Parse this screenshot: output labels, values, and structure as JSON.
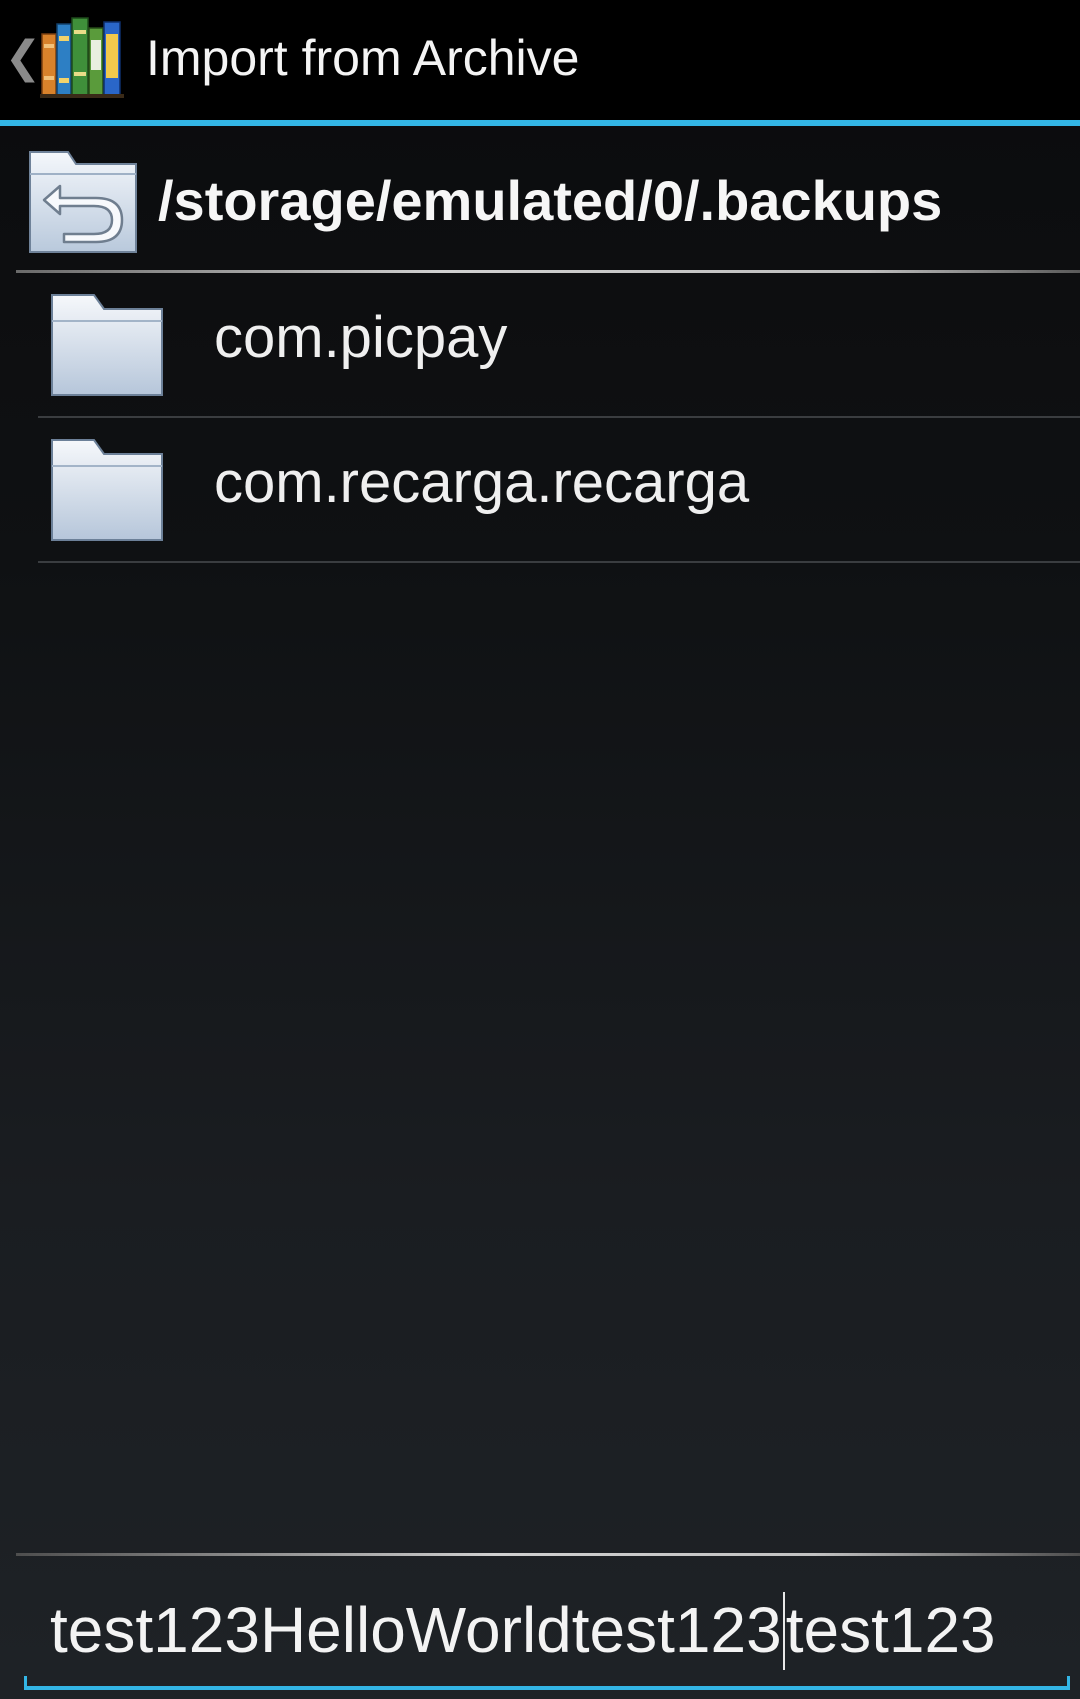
{
  "action_bar": {
    "title": "Import from Archive",
    "up_icon": "chevron-left-icon",
    "app_icon": "bookshelf-icon",
    "accent_color": "#33b5e5"
  },
  "path": {
    "current": "/storage/emulated/0/.backups",
    "icon": "folder-up-icon"
  },
  "folders": [
    {
      "name": "com.picpay",
      "icon": "folder-icon"
    },
    {
      "name": "com.recarga.recarga",
      "icon": "folder-icon"
    }
  ],
  "filename_input": {
    "value_before_cursor": "test123HelloWorldtest123",
    "value_after_cursor": "test123"
  }
}
